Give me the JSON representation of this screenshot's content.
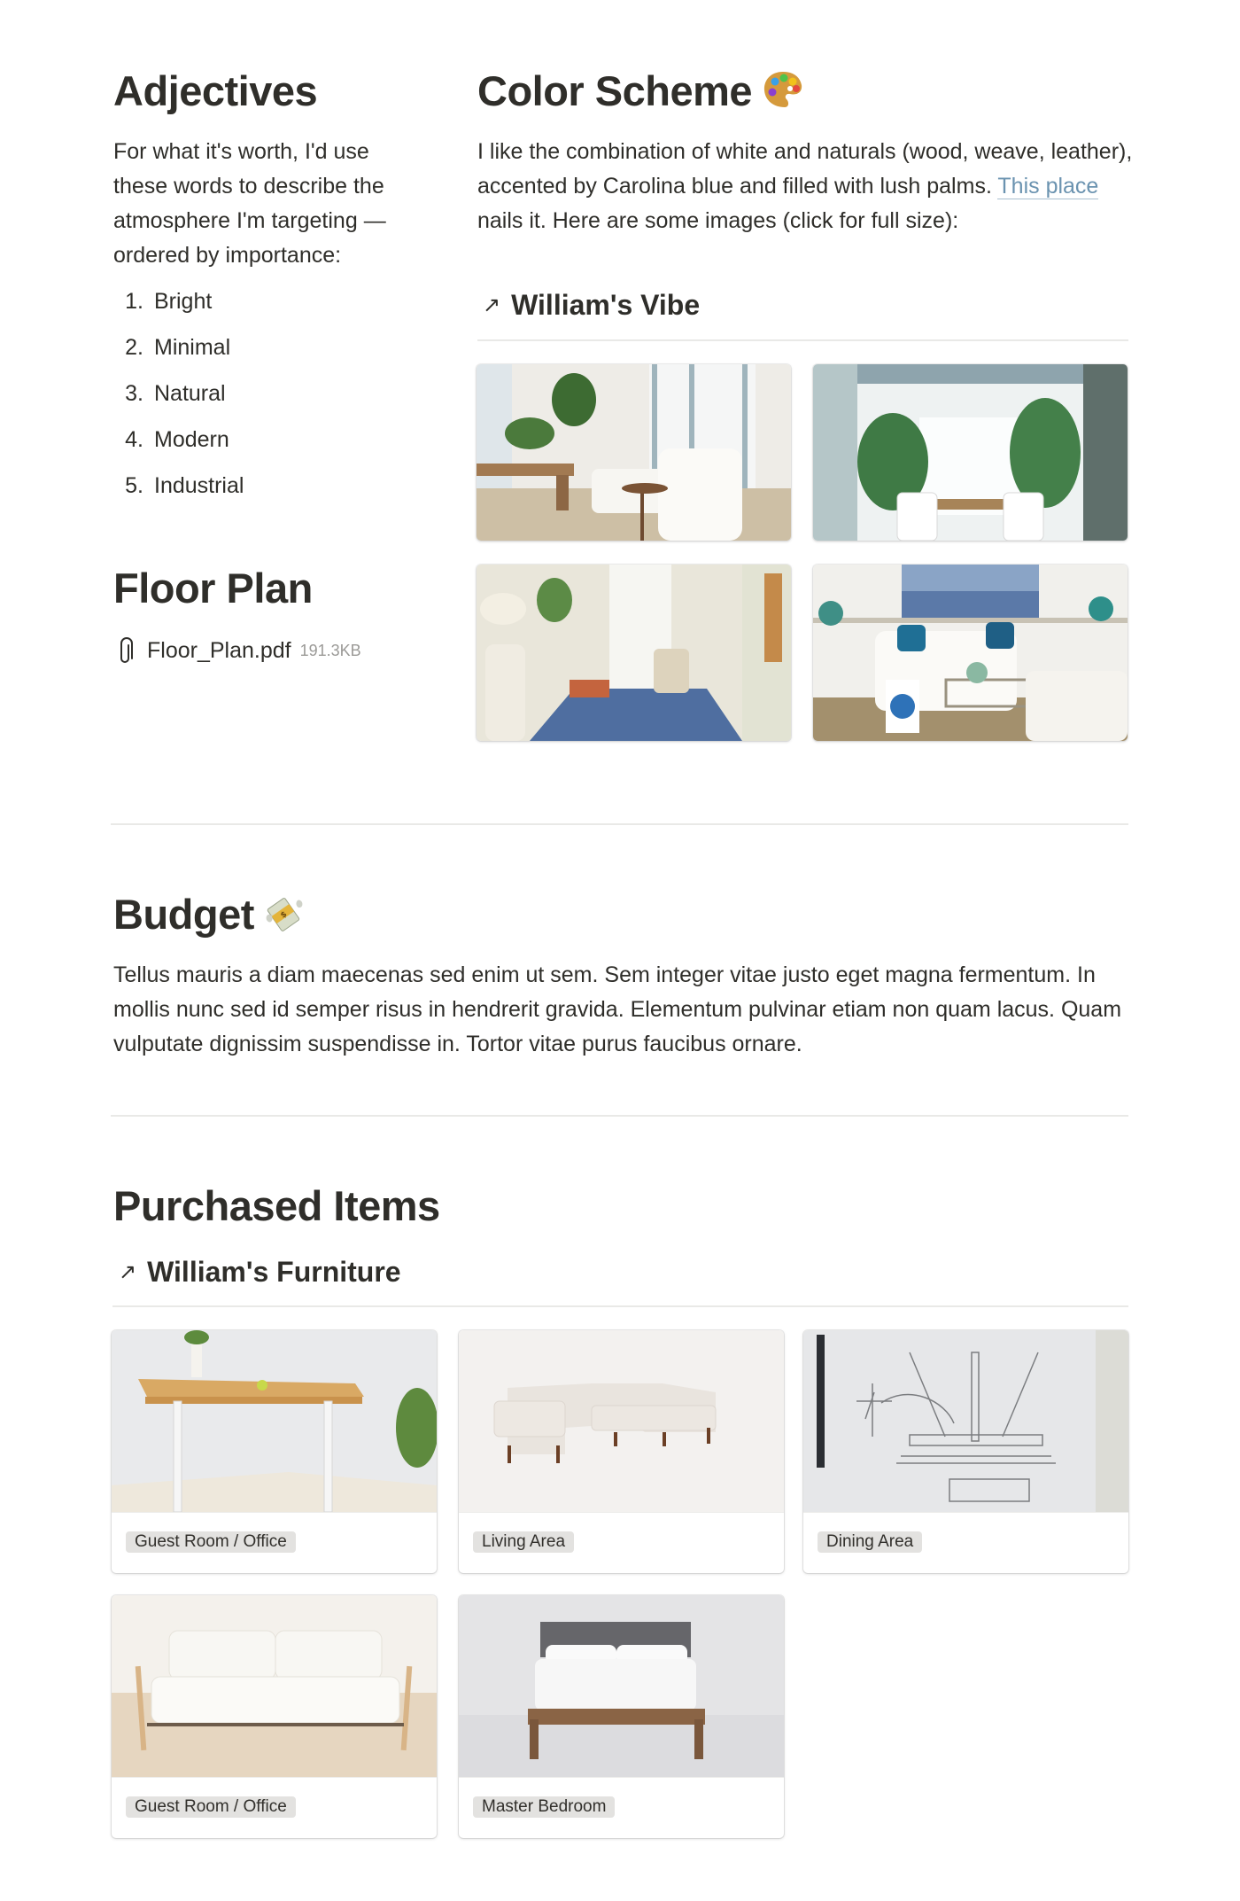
{
  "adjectives": {
    "title": "Adjectives",
    "intro": "For what it's worth, I'd use these words to describe the atmosphere I'm targeting — ordered by importance:",
    "items": [
      {
        "num": "1.",
        "label": "Bright"
      },
      {
        "num": "2.",
        "label": "Minimal"
      },
      {
        "num": "3.",
        "label": "Natural"
      },
      {
        "num": "4.",
        "label": "Modern"
      },
      {
        "num": "5.",
        "label": "Industrial"
      }
    ]
  },
  "floor_plan": {
    "title": "Floor Plan",
    "file_name": "Floor_Plan.pdf",
    "file_size": "191.3KB",
    "icon": "paperclip-icon"
  },
  "color_scheme": {
    "title": "Color Scheme",
    "emoji": "🎨",
    "text_before": "I like the combination of white and naturals (wood, weave, leather), accented by Carolina blue and filled with lush palms. ",
    "link_text": "This place",
    "text_after": " nails it. Here are some images (click for full size):",
    "linked_db": {
      "arrow": "↗",
      "title": "William's Vibe"
    },
    "gallery": [
      {
        "alt": "White living room with hanging rattan chair and fiddle leaf fig"
      },
      {
        "alt": "Dining nook with palms and white chairs"
      },
      {
        "alt": "Hallway with blue patterned rug and upholstered chair"
      },
      {
        "alt": "Coastal living room with blue pillows and abstract painting"
      }
    ]
  },
  "budget": {
    "title": "Budget",
    "emoji": "💸",
    "text": "Tellus mauris a diam maecenas sed enim ut sem. Sem integer vitae justo eget magna fermentum. In mollis nunc sed id semper risus in hendrerit gravida. Elementum pulvinar etiam non quam lacus. Quam vulputate dignissim suspendisse in. Tortor vitae purus faucibus ornare."
  },
  "purchased": {
    "title": "Purchased Items",
    "linked_db": {
      "arrow": "↗",
      "title": "William's Furniture"
    },
    "items": [
      {
        "tag": "Guest Room / Office",
        "image": "standing desk"
      },
      {
        "tag": "Living Area",
        "image": "sectional sofa"
      },
      {
        "tag": "Dining Area",
        "image": "table sketch"
      },
      {
        "tag": "Guest Room / Office",
        "image": "loveseat"
      },
      {
        "tag": "Master Bedroom",
        "image": "bed"
      }
    ]
  },
  "colors": {
    "text": "#2f2e2a",
    "link": "#6b93b0",
    "divider": "#e9e9e7",
    "tag_bg": "#e3e2e0",
    "muted": "#9b9a97"
  }
}
